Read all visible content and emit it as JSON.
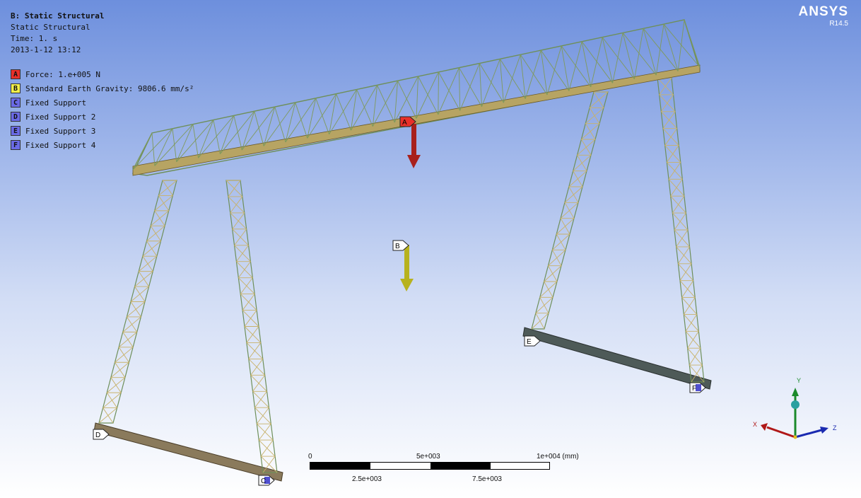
{
  "info": {
    "title": "B: Static Structural",
    "type": "Static Structural",
    "time": "Time: 1. s",
    "date": "2013-1-12 13:12"
  },
  "legend": [
    {
      "letter": "A",
      "label": "Force: 1.e+005 N",
      "color": "#e8302a"
    },
    {
      "letter": "B",
      "label": "Standard Earth Gravity: 9806.6 mm/s²",
      "color": "#f2ee4a"
    },
    {
      "letter": "C",
      "label": "Fixed Support",
      "color": "#6a6ae6"
    },
    {
      "letter": "D",
      "label": "Fixed Support 2",
      "color": "#6a6ae6"
    },
    {
      "letter": "E",
      "label": "Fixed Support 3",
      "color": "#6a6ae6"
    },
    {
      "letter": "F",
      "label": "Fixed Support 4",
      "color": "#6a6ae6"
    }
  ],
  "brand": {
    "name": "ANSYS",
    "version": "R14.5"
  },
  "scale_bar": {
    "top_labels": [
      "0",
      "5e+003",
      "1e+004 (mm)"
    ],
    "bottom_labels": [
      "2.5e+003",
      "7.5e+003"
    ]
  },
  "markers": {
    "A": "A",
    "B": "B",
    "C": "C",
    "D": "D",
    "E": "E",
    "F": "F"
  },
  "triad": {
    "x": "X",
    "y": "Y",
    "z": "Z"
  }
}
